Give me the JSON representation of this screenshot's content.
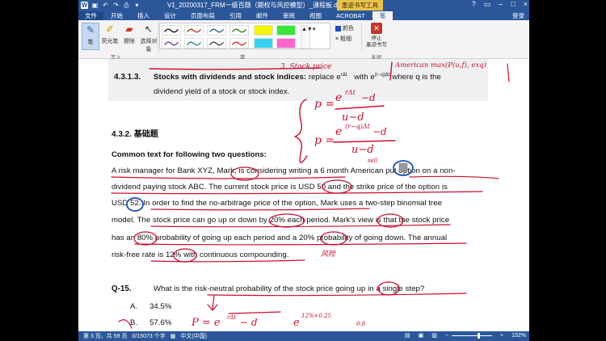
{
  "window": {
    "title": "V1_20200317_FRM一级百题（期权与风控模型）_课程板.docx - Mi...",
    "context_group": "墨迹书写工具",
    "login": "登录"
  },
  "ribbon_tabs": [
    "文件",
    "开始",
    "插入",
    "设计",
    "页面布局",
    "引用",
    "邮件",
    "审阅",
    "视图",
    "ACROBAT",
    "笔"
  ],
  "ribbon": {
    "tools": [
      {
        "label": "笔"
      },
      {
        "label": "荧光笔"
      },
      {
        "label": "擦除"
      },
      {
        "label": "选择对象"
      }
    ],
    "group_write": "写入",
    "group_pens": "笔",
    "group_close": "关闭",
    "color_label": "颜色",
    "thickness_label": "粗细",
    "stop_label": "停止\n墨迹书写",
    "pen_colors": [
      "#111111",
      "#c0392b",
      "#2e5f9e",
      "#2d7a2d",
      "#6b3fa0",
      "#1b8a8a",
      "#444444",
      "#d7261f"
    ],
    "highlighter_colors": [
      "#f5f500",
      "#39e639",
      "#36d3f0",
      "#ff66cc"
    ]
  },
  "document": {
    "sec_4313_number": "4.3.1.3.",
    "sec_4313_bold": "Stocks with dividends and stock indices:",
    "sec_4313_text1": "replace",
    "sec_4313_exp1": "e",
    "sec_4313_sup1": "rΔt",
    "sec_4313_with": "with",
    "sec_4313_exp2": "e",
    "sec_4313_sup2": "(r−q)Δt",
    "sec_4313_text2": "where q is the",
    "sec_4313_line2": "dividend yield of a stock or stock index.",
    "sec_432": "4.3.2.   基础题",
    "common": "Common text for following two questions:",
    "para_lines": [
      "A risk manager for Bank XYZ, Mark, is considering writing a 6 month American put option on a non-",
      "dividend paying stock ABC. The current stock price is USD 50 and the strike price of the option is",
      "USD 52. In order to find the no-arbitrage price of the option, Mark uses a two-step binomial tree",
      "model. The stock price can go up or down by 20% each period. Mark's view is that the stock price",
      "has an 80% probability of going up each period and a 20% probability of going down. The annual",
      "risk-free rate is 12% with continuous compounding."
    ],
    "q15_label": "Q-15.",
    "q15_text": "What is the risk-neutral probability of the stock price going up in a single step?",
    "optA_label": "A.",
    "optA_text": "34.5%",
    "optB_label": "B.",
    "optB_text": "57.6%"
  },
  "annotations": {
    "top_note_1": "3. Stock price",
    "top_note_2": "American  max(P(u,f), exq)",
    "formula_p1_top": "e",
    "formula_p1_sup": "rΔt",
    "formula_p1_minus": "−d",
    "formula_p1_bottom": "u−d",
    "formula_p2_top": "e",
    "formula_p2_sup": "(r−q)Δt",
    "formula_p2_minus": "−d",
    "formula_p2_bottom": "u−d",
    "p_label": "p =",
    "small_note": "sell",
    "bottom_formula": "P = e",
    "bottom_sup": "rΔt",
    "bottom_minus": "− d",
    "bottom_e": "e",
    "bottom_sup2": "12%×0.25",
    "bottom_d": "0.8",
    "risk_note": "风险",
    "ink_color": "#c8102e",
    "ink_blue": "#1f4fb5"
  },
  "status": {
    "page": "第 3 页，共 59 页",
    "words": "0/15073 个字",
    "lang": "中文(中国)",
    "zoom": "152%"
  }
}
